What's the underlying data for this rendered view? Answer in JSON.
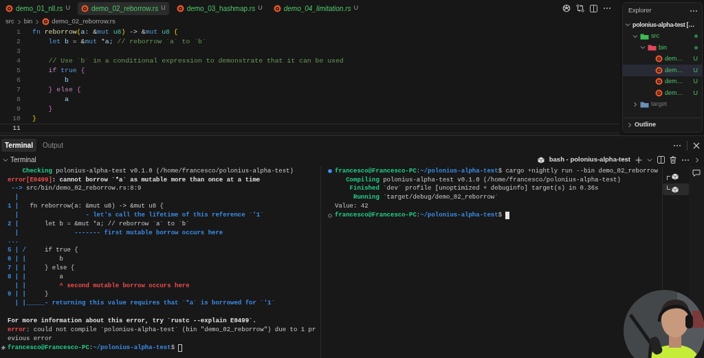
{
  "tabs": [
    {
      "label": "demo_01_nll.rs",
      "badge": "U",
      "selected": false,
      "preview": false
    },
    {
      "label": "demo_02_reborrow.rs",
      "badge": "U",
      "selected": true,
      "preview": false
    },
    {
      "label": "demo_03_hashmap.rs",
      "badge": "U",
      "selected": false,
      "preview": false
    },
    {
      "label": "demo_04_limitation.rs",
      "badge": "U",
      "selected": false,
      "preview": true
    }
  ],
  "breadcrumb": [
    "src",
    "bin",
    "demo_02_reborrow.rs"
  ],
  "code_lines": [
    {
      "number": "1",
      "current": false,
      "tokens": [
        {
          "text": "fn",
          "kind": "keyword"
        },
        {
          "text": " reborrow",
          "kind": "function"
        },
        {
          "text": "(",
          "kind": "bracket1"
        },
        {
          "text": "a",
          "kind": "variable"
        },
        {
          "text": ": &",
          "kind": "punct"
        },
        {
          "text": "mut",
          "kind": "keyword"
        },
        {
          "text": " u8",
          "kind": "type"
        },
        {
          "text": ")",
          "kind": "bracket1"
        },
        {
          "text": " -> &",
          "kind": "punct"
        },
        {
          "text": "mut",
          "kind": "keyword"
        },
        {
          "text": " u8",
          "kind": "type"
        },
        {
          "text": " {",
          "kind": "bracket1"
        }
      ]
    },
    {
      "number": "2",
      "current": false,
      "tokens": [
        {
          "text": "    let",
          "kind": "keyword"
        },
        {
          "text": " b",
          "kind": "variable"
        },
        {
          "text": " = &",
          "kind": "punct"
        },
        {
          "text": "mut",
          "kind": "keyword"
        },
        {
          "text": " *",
          "kind": "punct"
        },
        {
          "text": "a",
          "kind": "variable"
        },
        {
          "text": ";",
          "kind": "punct"
        },
        {
          "text": " // reborrow `a` to `b`",
          "kind": "comment"
        }
      ]
    },
    {
      "number": "3",
      "current": false
    },
    {
      "number": "4",
      "current": false,
      "tokens": [
        {
          "text": "    // Use `b` in a conditional expression to demonstrate that it can be used",
          "kind": "comment"
        }
      ]
    },
    {
      "number": "5",
      "current": false,
      "tokens": [
        {
          "text": "    if",
          "kind": "control"
        },
        {
          "text": " true",
          "kind": "keyword"
        },
        {
          "text": " {",
          "kind": "bracket2"
        }
      ]
    },
    {
      "number": "6",
      "current": false,
      "tokens": [
        {
          "text": "        b",
          "kind": "variable"
        }
      ]
    },
    {
      "number": "7",
      "current": false,
      "tokens": [
        {
          "text": "    }",
          "kind": "bracket2"
        },
        {
          "text": " else",
          "kind": "control"
        },
        {
          "text": " {",
          "kind": "bracket2"
        }
      ]
    },
    {
      "number": "8",
      "current": false,
      "tokens": [
        {
          "text": "        a",
          "kind": "variable"
        }
      ]
    },
    {
      "number": "9",
      "current": false,
      "tokens": [
        {
          "text": "    }",
          "kind": "bracket2"
        }
      ]
    },
    {
      "number": "10",
      "current": false,
      "tokens": [
        {
          "text": "}",
          "kind": "bracket1"
        }
      ]
    },
    {
      "number": "11",
      "current": true
    }
  ],
  "explorer": {
    "title": "Explorer",
    "tree": [
      {
        "label": "polonius-alpha-test […",
        "kind": "root",
        "expanded": true,
        "selected": false,
        "children": [
          {
            "label": "src",
            "kind": "folder",
            "expanded": true,
            "selected": false,
            "modified": true,
            "untracked": true,
            "color": "#3fb950",
            "children": [
              {
                "label": "bin",
                "kind": "folder",
                "expanded": true,
                "selected": false,
                "modified": true,
                "untracked": true,
                "color": "#e0485c",
                "children": [
                  {
                    "label": "dem…",
                    "kind": "file",
                    "badge": "U",
                    "untracked": true,
                    "selected": false
                  },
                  {
                    "label": "dem…",
                    "kind": "file",
                    "badge": "U",
                    "untracked": true,
                    "selected": true
                  },
                  {
                    "label": "dem…",
                    "kind": "file",
                    "badge": "U",
                    "untracked": true,
                    "selected": false
                  },
                  {
                    "label": "dem…",
                    "kind": "file",
                    "badge": "U",
                    "untracked": true,
                    "selected": false
                  }
                ]
              }
            ]
          },
          {
            "label": "target",
            "kind": "folder",
            "expanded": false,
            "selected": false,
            "modified": false,
            "ignored": true,
            "color": "#6b8fb5"
          }
        ]
      }
    ],
    "outline": {
      "label": "Outline",
      "expanded": false
    }
  },
  "panel_tabs": [
    {
      "label": "Terminal",
      "selected": true
    },
    {
      "label": "Output",
      "selected": false
    }
  ],
  "terminal_header": {
    "label": "Terminal",
    "expanded": true,
    "shell": "bash - polonius-alpha-test"
  },
  "terminals": [
    {
      "focused": false,
      "lines": [
        {
          "kind": "output",
          "segments": [
            {
              "text": "    Checking",
              "kind": "status"
            },
            {
              "text": " polonius-alpha-test v0.1.0 (/home/francesco/polonius-alpha-test)",
              "kind": "text"
            }
          ]
        },
        {
          "kind": "output",
          "segments": [
            {
              "text": "error[E0499]",
              "kind": "fail"
            },
            {
              "text": ": cannot borrow `*a` as mutable more than once at a time",
              "kind": "strong"
            }
          ]
        },
        {
          "kind": "output",
          "segments": [
            {
              "text": " -->",
              "kind": "gutter"
            },
            {
              "text": " src/bin/demo_02_reborrow.rs:8:9",
              "kind": "text"
            }
          ]
        },
        {
          "kind": "output",
          "segments": [
            {
              "text": "  |",
              "kind": "gutter"
            }
          ]
        },
        {
          "kind": "output",
          "segments": [
            {
              "text": "1 |",
              "kind": "gutter"
            },
            {
              "text": "   fn reborrow(a: &mut u8) -> &mut u8 {",
              "kind": "text"
            }
          ]
        },
        {
          "kind": "output",
          "segments": [
            {
              "text": "  |",
              "kind": "gutter"
            },
            {
              "text": "                  - let's call the lifetime of this reference `'1`",
              "kind": "note"
            }
          ]
        },
        {
          "kind": "output",
          "segments": [
            {
              "text": "2 |",
              "kind": "gutter"
            },
            {
              "text": "       let b = &mut *a; // reborrow `a` to `b`",
              "kind": "text"
            }
          ]
        },
        {
          "kind": "output",
          "segments": [
            {
              "text": "  |",
              "kind": "gutter"
            },
            {
              "text": "               ------- first mutable borrow occurs here",
              "kind": "note"
            }
          ]
        },
        {
          "kind": "output",
          "segments": [
            {
              "text": "...",
              "kind": "gutter"
            }
          ]
        },
        {
          "kind": "output",
          "segments": [
            {
              "text": "5 | /",
              "kind": "gutter"
            },
            {
              "text": "     if true {",
              "kind": "text"
            }
          ]
        },
        {
          "kind": "output",
          "segments": [
            {
              "text": "6 | |",
              "kind": "gutter"
            },
            {
              "text": "         b",
              "kind": "text"
            }
          ]
        },
        {
          "kind": "output",
          "segments": [
            {
              "text": "7 | |",
              "kind": "gutter"
            },
            {
              "text": "     } else {",
              "kind": "text"
            }
          ]
        },
        {
          "kind": "output",
          "segments": [
            {
              "text": "8 | |",
              "kind": "gutter"
            },
            {
              "text": "         a",
              "kind": "text"
            }
          ]
        },
        {
          "kind": "output",
          "segments": [
            {
              "text": "  | |",
              "kind": "gutter"
            },
            {
              "text": "         ^ second mutable borrow occurs here",
              "kind": "fail"
            }
          ]
        },
        {
          "kind": "output",
          "segments": [
            {
              "text": "9 | |",
              "kind": "gutter"
            },
            {
              "text": "     }",
              "kind": "text"
            }
          ]
        },
        {
          "kind": "output",
          "segments": [
            {
              "text": "  | |_____- returning this value requires that `*a` is borrowed for `'1`",
              "kind": "note"
            }
          ]
        },
        {
          "kind": "blank"
        },
        {
          "kind": "output",
          "segments": [
            {
              "text": "For more information about this error, try `rustc --explain E0499`.",
              "kind": "strong"
            }
          ]
        },
        {
          "kind": "output",
          "segments": [
            {
              "text": "error",
              "kind": "fail"
            },
            {
              "text": ": could not compile `polonius-alpha-test` (bin \"demo_02_reborrow\") due to 1 pr",
              "kind": "text"
            }
          ]
        },
        {
          "kind": "output",
          "segments": [
            {
              "text": "evious error",
              "kind": "text"
            }
          ]
        },
        {
          "kind": "hint",
          "cursor": true,
          "segments": [
            {
              "text": "francesco@Francesco-PC",
              "kind": "user"
            },
            {
              "text": ":",
              "kind": "text"
            },
            {
              "text": "~/polonius-alpha-test",
              "kind": "path"
            },
            {
              "text": "$ ",
              "kind": "text"
            }
          ]
        }
      ]
    },
    {
      "focused": true,
      "lines": [
        {
          "kind": "done",
          "segments": [
            {
              "text": "francesco@Francesco-PC",
              "kind": "user"
            },
            {
              "text": ":",
              "kind": "text"
            },
            {
              "text": "~/polonius-alpha-test",
              "kind": "path"
            },
            {
              "text": "$ cargo +nightly run --bin demo_02_reborrow",
              "kind": "text"
            }
          ]
        },
        {
          "kind": "output",
          "segments": [
            {
              "text": "   Compiling",
              "kind": "status"
            },
            {
              "text": " polonius-alpha-test v0.1.0 (/home/francesco/polonius-alpha-test)",
              "kind": "text"
            }
          ]
        },
        {
          "kind": "output",
          "segments": [
            {
              "text": "    Finished",
              "kind": "status"
            },
            {
              "text": " `dev` profile [unoptimized + debuginfo] target(s) in 0.36s",
              "kind": "text"
            }
          ]
        },
        {
          "kind": "output",
          "segments": [
            {
              "text": "     Running",
              "kind": "status"
            },
            {
              "text": " `target/debug/demo_02_reborrow`",
              "kind": "text"
            }
          ]
        },
        {
          "kind": "output",
          "segments": [
            {
              "text": "Value: 42",
              "kind": "text"
            }
          ]
        },
        {
          "kind": "pending",
          "cursor": true,
          "segments": [
            {
              "text": "francesco@Francesco-PC",
              "kind": "user"
            },
            {
              "text": ":",
              "kind": "text"
            },
            {
              "text": "~/polonius-alpha-test",
              "kind": "path"
            },
            {
              "text": "$ ",
              "kind": "text"
            }
          ]
        }
      ]
    }
  ],
  "terminal_list": [
    {
      "selected": false
    },
    {
      "selected": true
    }
  ],
  "webcam": {
    "kind": "picture"
  }
}
